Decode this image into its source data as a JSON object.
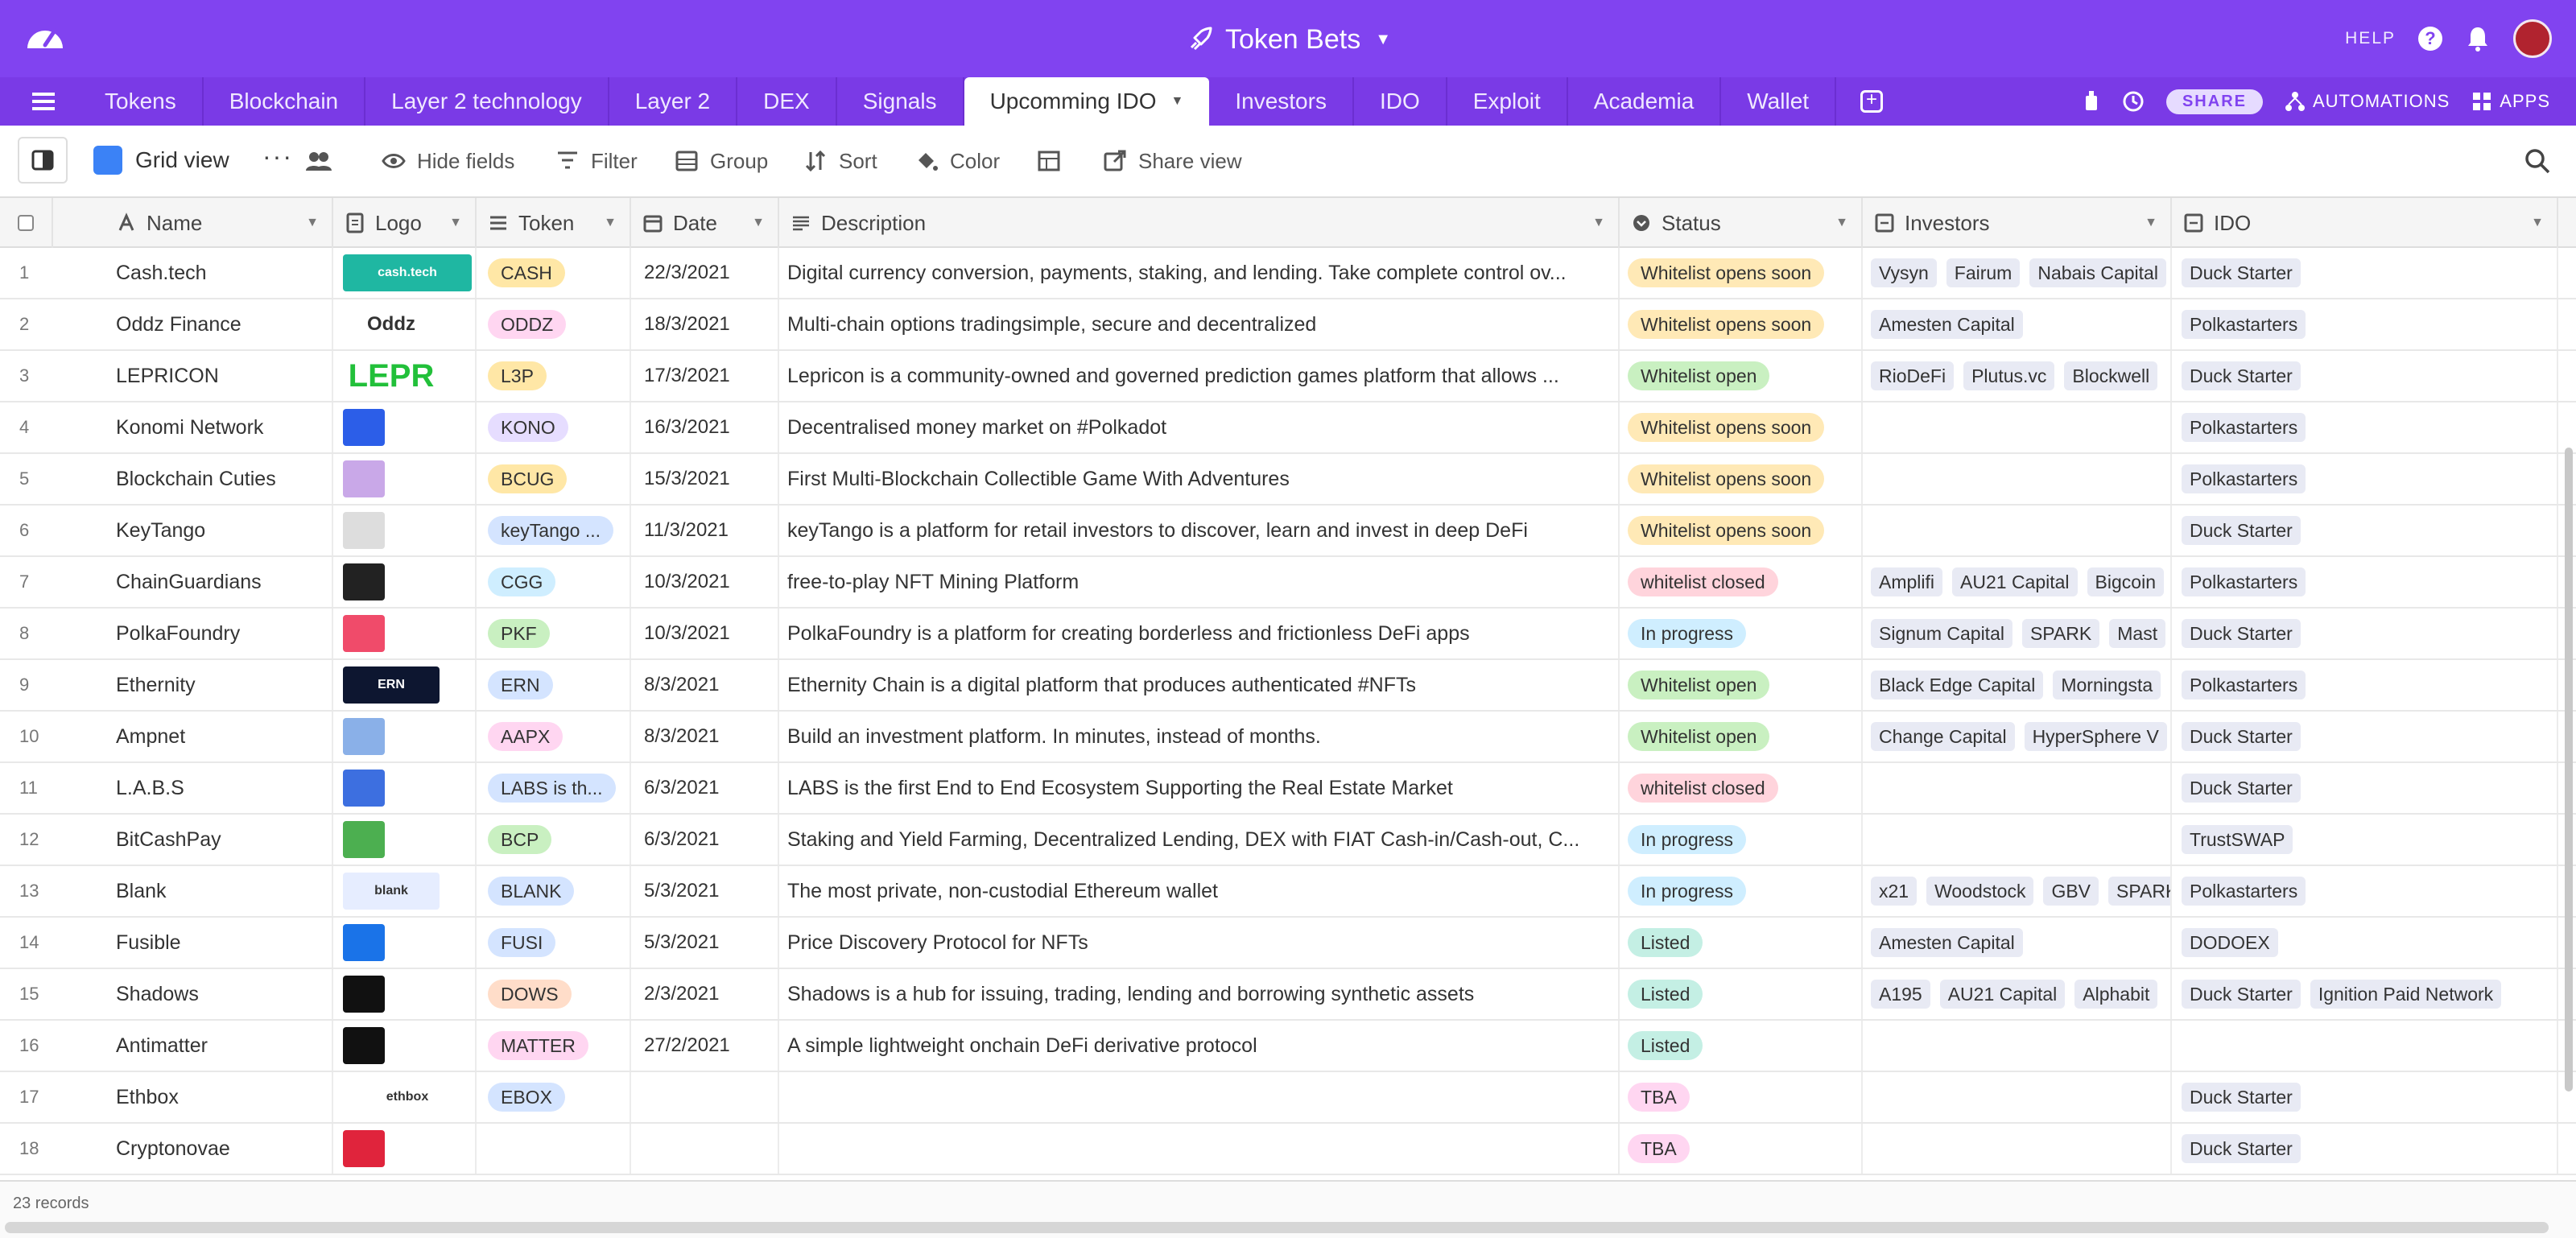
{
  "app": {
    "base_name": "Token Bets",
    "help_label": "HELP"
  },
  "tabs": [
    {
      "label": "Tokens"
    },
    {
      "label": "Blockchain"
    },
    {
      "label": "Layer 2 technology"
    },
    {
      "label": "Layer 2"
    },
    {
      "label": "DEX"
    },
    {
      "label": "Signals"
    },
    {
      "label": "Upcomming IDO",
      "active": true
    },
    {
      "label": "Investors"
    },
    {
      "label": "IDO"
    },
    {
      "label": "Exploit"
    },
    {
      "label": "Academia"
    },
    {
      "label": "Wallet"
    }
  ],
  "tab_right": {
    "share": "SHARE",
    "automations": "AUTOMATIONS",
    "apps": "APPS"
  },
  "toolbar": {
    "view_name": "Grid view",
    "view_more": "···",
    "hide_fields": "Hide fields",
    "filter": "Filter",
    "group": "Group",
    "sort": "Sort",
    "color": "Color",
    "share_view": "Share view"
  },
  "columns": {
    "name": "Name",
    "logo": "Logo",
    "token": "Token",
    "date": "Date",
    "description": "Description",
    "status": "Status",
    "investors": "Investors",
    "ido": "IDO"
  },
  "status_colors": {
    "Whitelist opens soon": "#ffe9b6",
    "Whitelist open": "#c9f0c1",
    "whitelist closed": "#ffd4dc",
    "In progress": "#cfeeff",
    "Listed": "#c4efe4",
    "TBA": "#ffd6f1"
  },
  "token_colors": [
    "#ffe7a6",
    "#ffd6f1",
    "#ffe7a6",
    "#e6ddff",
    "#ffe7a6",
    "#d4e4ff",
    "#cfeeff",
    "#c9f0c1",
    "#d4e4ff",
    "#ffd6f1",
    "#d4e4ff",
    "#c9f0c1",
    "#d4e4ff",
    "#d4e4ff",
    "#ffddc9",
    "#ffd6f1",
    "#d4e4ff"
  ],
  "rows": [
    {
      "num": "1",
      "name": "Cash.tech",
      "logo": "cash.tech",
      "logo_color": "#1fb7a2",
      "token": "CASH",
      "date": "22/3/2021",
      "description": "Digital currency conversion, payments, staking, and lending. Take complete control ov...",
      "status": "Whitelist opens soon",
      "investors": [
        "Vysyn",
        "Fairum",
        "Nabais Capital"
      ],
      "ido": [
        "Duck Starter"
      ]
    },
    {
      "num": "2",
      "name": "Oddz Finance",
      "logo": "Oddz",
      "logo_color": "#333333",
      "token": "ODDZ",
      "date": "18/3/2021",
      "description": "Multi-chain options tradingsimple, secure and decentralized",
      "status": "Whitelist opens soon",
      "investors": [
        "Amesten Capital"
      ],
      "ido": [
        "Polkastarters"
      ]
    },
    {
      "num": "3",
      "name": "LEPRICON",
      "logo": "LEPR",
      "logo_color": "#22c03a",
      "token": "L3P",
      "date": "17/3/2021",
      "description": "Lepricon is a community-owned and governed prediction games platform that allows ...",
      "status": "Whitelist open",
      "investors": [
        "RioDeFi",
        "Plutus.vc",
        "Blockwell"
      ],
      "ido": [
        "Duck Starter"
      ]
    },
    {
      "num": "4",
      "name": "Konomi Network",
      "logo": "",
      "logo_color": "#2c5ee8",
      "token": "KONO",
      "date": "16/3/2021",
      "description": "Decentralised money market on #Polkadot",
      "status": "Whitelist opens soon",
      "investors": [],
      "ido": [
        "Polkastarters"
      ]
    },
    {
      "num": "5",
      "name": "Blockchain Cuties",
      "logo": "",
      "logo_color": "#c9a8e8",
      "token": "BCUG",
      "date": "15/3/2021",
      "description": "First Multi-Blockchain Collectible Game With Adventures",
      "status": "Whitelist opens soon",
      "investors": [],
      "ido": [
        "Polkastarters"
      ]
    },
    {
      "num": "6",
      "name": "KeyTango",
      "logo": "",
      "logo_color": "#dddddd",
      "token": "keyTango ...",
      "date": "11/3/2021",
      "description": "keyTango is a platform for retail investors to discover, learn and invest in deep DeFi",
      "status": "Whitelist opens soon",
      "investors": [],
      "ido": [
        "Duck Starter"
      ]
    },
    {
      "num": "7",
      "name": "ChainGuardians",
      "logo": "",
      "logo_color": "#222222",
      "token": "CGG",
      "date": "10/3/2021",
      "description": "free-to-play NFT Mining Platform",
      "status": "whitelist closed",
      "investors": [
        "Amplifi",
        "AU21 Capital",
        "Bigcoin"
      ],
      "ido": [
        "Polkastarters"
      ]
    },
    {
      "num": "8",
      "name": "PolkaFoundry",
      "logo": "",
      "logo_color": "#f04b6a",
      "token": "PKF",
      "date": "10/3/2021",
      "description": "PolkaFoundry is a platform for creating borderless and frictionless DeFi apps",
      "status": "In progress",
      "investors": [
        "Signum Capital",
        "SPARK",
        "Mast"
      ],
      "ido": [
        "Duck Starter"
      ]
    },
    {
      "num": "9",
      "name": "Ethernity",
      "logo": "ERN",
      "logo_color": "#0d1630",
      "token": "ERN",
      "date": "8/3/2021",
      "description": "Ethernity Chain is a digital platform that produces authenticated #NFTs",
      "status": "Whitelist open",
      "investors": [
        "Black Edge Capital",
        "Morningsta"
      ],
      "ido": [
        "Polkastarters"
      ]
    },
    {
      "num": "10",
      "name": "Ampnet",
      "logo": "",
      "logo_color": "#8ab0e8",
      "token": "AAPX",
      "date": "8/3/2021",
      "description": "Build an investment platform. In minutes, instead of months.",
      "status": "Whitelist open",
      "investors": [
        "Change Capital",
        "HyperSphere V"
      ],
      "ido": [
        "Duck Starter"
      ]
    },
    {
      "num": "11",
      "name": "L.A.B.S",
      "logo": "",
      "logo_color": "#3d6fe0",
      "token": "LABS is th...",
      "date": "6/3/2021",
      "description": "LABS is the first End to End Ecosystem Supporting the Real Estate Market",
      "status": "whitelist closed",
      "investors": [],
      "ido": [
        "Duck Starter"
      ]
    },
    {
      "num": "12",
      "name": "BitCashPay",
      "logo": "",
      "logo_color": "#4caf50",
      "token": "BCP",
      "date": "6/3/2021",
      "description": "Staking and Yield Farming, Decentralized Lending, DEX with FIAT Cash-in/Cash-out, C...",
      "status": "In progress",
      "investors": [],
      "ido": [
        "TrustSWAP"
      ]
    },
    {
      "num": "13",
      "name": "Blank",
      "logo": "blank",
      "logo_color": "#e6edff",
      "token": "BLANK",
      "date": "5/3/2021",
      "description": "The most private, non-custodial Ethereum wallet",
      "status": "In progress",
      "investors": [
        "x21",
        "Woodstock",
        "GBV",
        "SPARK"
      ],
      "ido": [
        "Polkastarters"
      ]
    },
    {
      "num": "14",
      "name": "Fusible",
      "logo": "",
      "logo_color": "#1a73e8",
      "token": "FUSI",
      "date": "5/3/2021",
      "description": "Price Discovery Protocol for NFTs",
      "status": "Listed",
      "investors": [
        "Amesten Capital"
      ],
      "ido": [
        "DODOEX"
      ]
    },
    {
      "num": "15",
      "name": "Shadows",
      "logo": "",
      "logo_color": "#111111",
      "token": "DOWS",
      "date": "2/3/2021",
      "description": "Shadows is a hub for issuing, trading, lending and borrowing synthetic assets",
      "status": "Listed",
      "investors": [
        "A195",
        "AU21 Capital",
        "Alphabit"
      ],
      "ido": [
        "Duck Starter",
        "Ignition Paid Network"
      ]
    },
    {
      "num": "16",
      "name": "Antimatter",
      "logo": "",
      "logo_color": "#111111",
      "token": "MATTER",
      "date": "27/2/2021",
      "description": "A simple lightweight onchain DeFi derivative protocol",
      "status": "Listed",
      "investors": [],
      "ido": []
    },
    {
      "num": "17",
      "name": "Ethbox",
      "logo": "ethbox",
      "logo_color": "#ffffff",
      "token": "EBOX",
      "date": "",
      "description": "",
      "status": "TBA",
      "investors": [],
      "ido": [
        "Duck Starter"
      ]
    },
    {
      "num": "18",
      "name": "Cryptonovae",
      "logo": "",
      "logo_color": "#e0243c",
      "token": "",
      "date": "",
      "description": "",
      "status": "TBA",
      "investors": [],
      "ido": [
        "Duck Starter"
      ]
    }
  ],
  "footer": {
    "record_count": "23 records"
  }
}
